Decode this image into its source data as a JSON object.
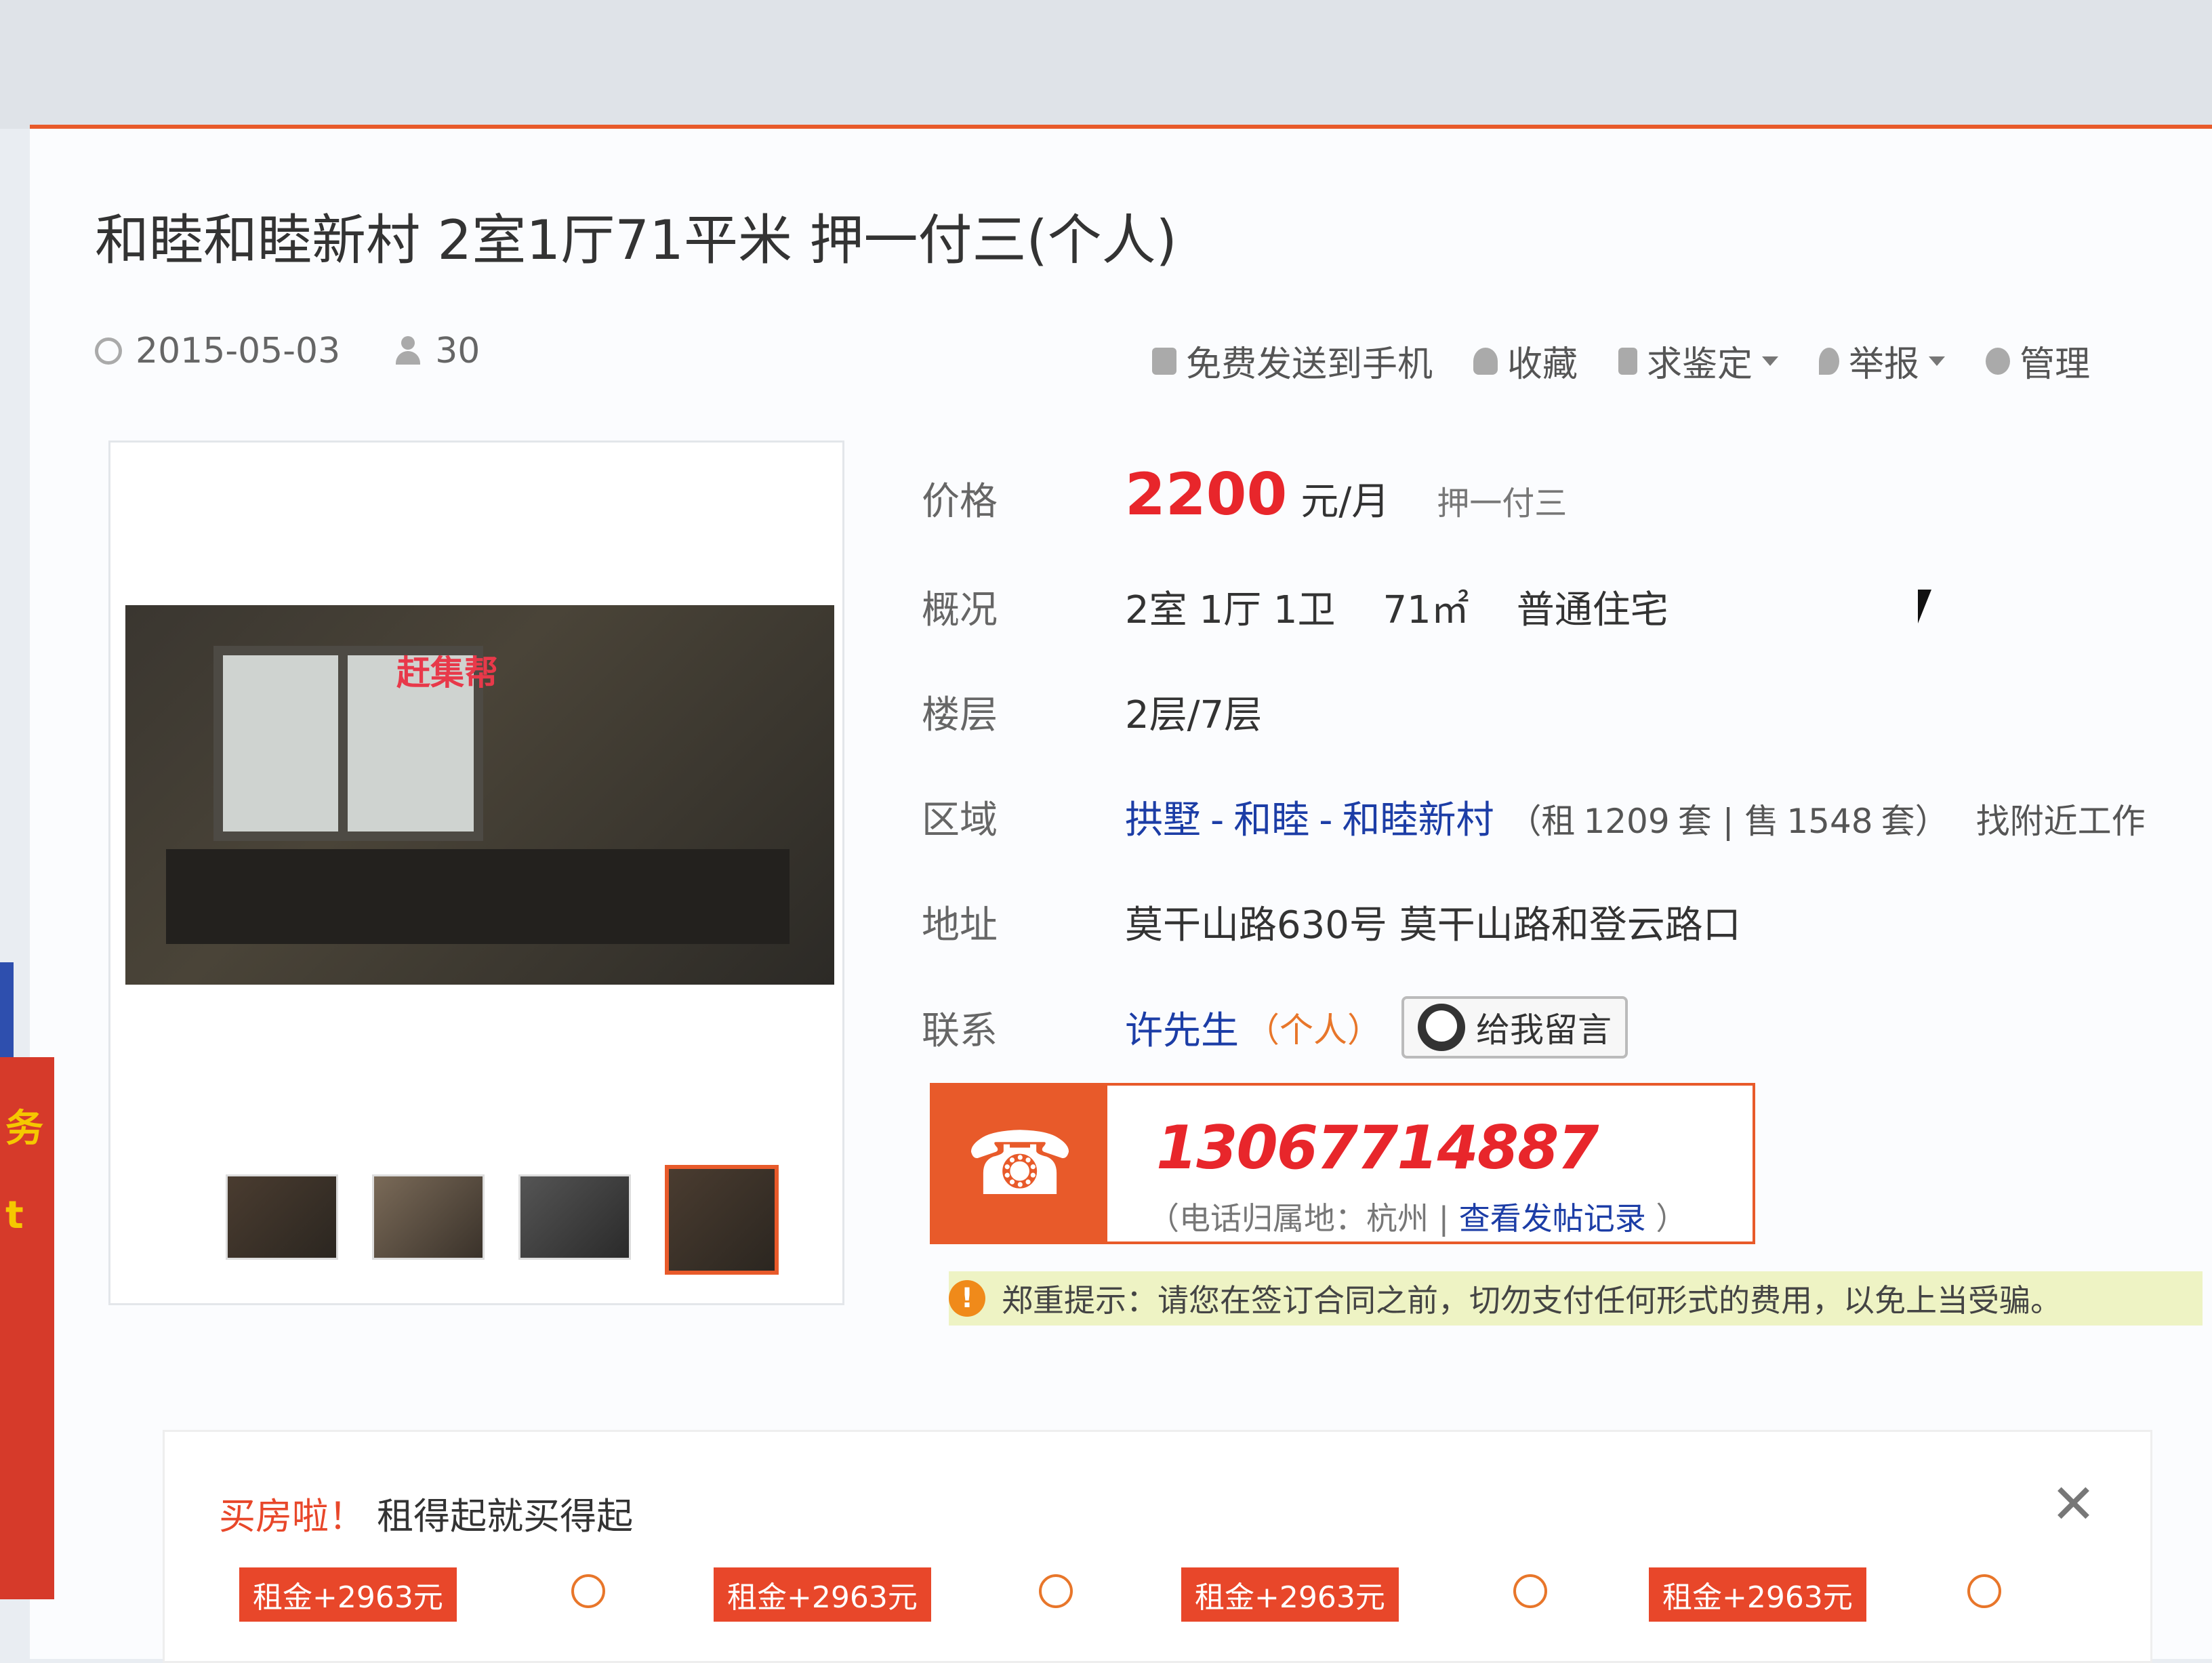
{
  "listing": {
    "title": "和睦和睦新村 2室1厅71平米 押一付三(个人)",
    "date": "2015-05-03",
    "views": "30"
  },
  "actions": {
    "send_to_phone": "免费发送到手机",
    "favorite": "收藏",
    "appraise": "求鉴定",
    "report": "举报",
    "manage": "管理"
  },
  "gallery": {
    "watermark": "赶集帮"
  },
  "fields": {
    "price_label": "价格",
    "price_value": "2200",
    "price_unit": "元/月",
    "price_deposit": "押一付三",
    "overview_label": "概况",
    "overview_rooms": "2室 1厅 1卫",
    "overview_area": "71㎡",
    "overview_type": "普通住宅",
    "floor_label": "楼层",
    "floor_value": "2层/7层",
    "area_label": "区域",
    "area_district": "拱墅",
    "area_sep1": "-",
    "area_sub": "和睦",
    "area_sep2": "-",
    "area_community": "和睦新村",
    "area_stats_open": "（租",
    "area_rent_count": "1209",
    "area_rent_unit": "套 | 售",
    "area_sale_count": "1548",
    "area_sale_unit": "套）",
    "area_jobs_link": "找附近工作",
    "address_label": "地址",
    "address_value": "莫干山路630号 莫干山路和登云路口",
    "contact_label": "联系",
    "contact_name": "许先生",
    "contact_type": "（个人）",
    "message_button": "给我留言"
  },
  "phone": {
    "number": "13067714887",
    "sub_prefix": "（电话归属地：杭州  |",
    "history_link": "查看发帖记录",
    "sub_suffix": "）"
  },
  "warning": {
    "text": "郑重提示：请您在签订合同之前，切勿支付任何形式的费用，以免上当受骗。"
  },
  "promo": {
    "title_red": "买房啦！",
    "title_rest": "租得起就买得起",
    "close": "✕",
    "tags": [
      "租金+2963元",
      "租金+2963元",
      "租金+2963元",
      "租金+2963元"
    ]
  },
  "colors": {
    "accent": "#e85a2a",
    "price": "#e8262b",
    "link": "#1c3da6",
    "warning_bg": "#eef3c4"
  },
  "icons": [
    "clock-icon",
    "user-icon",
    "phone-icon",
    "heart-icon",
    "share-icon",
    "pin-icon",
    "gear-icon",
    "smile-icon",
    "handset-icon",
    "warning-icon",
    "close-icon",
    "play-icon",
    "cursor-icon"
  ]
}
